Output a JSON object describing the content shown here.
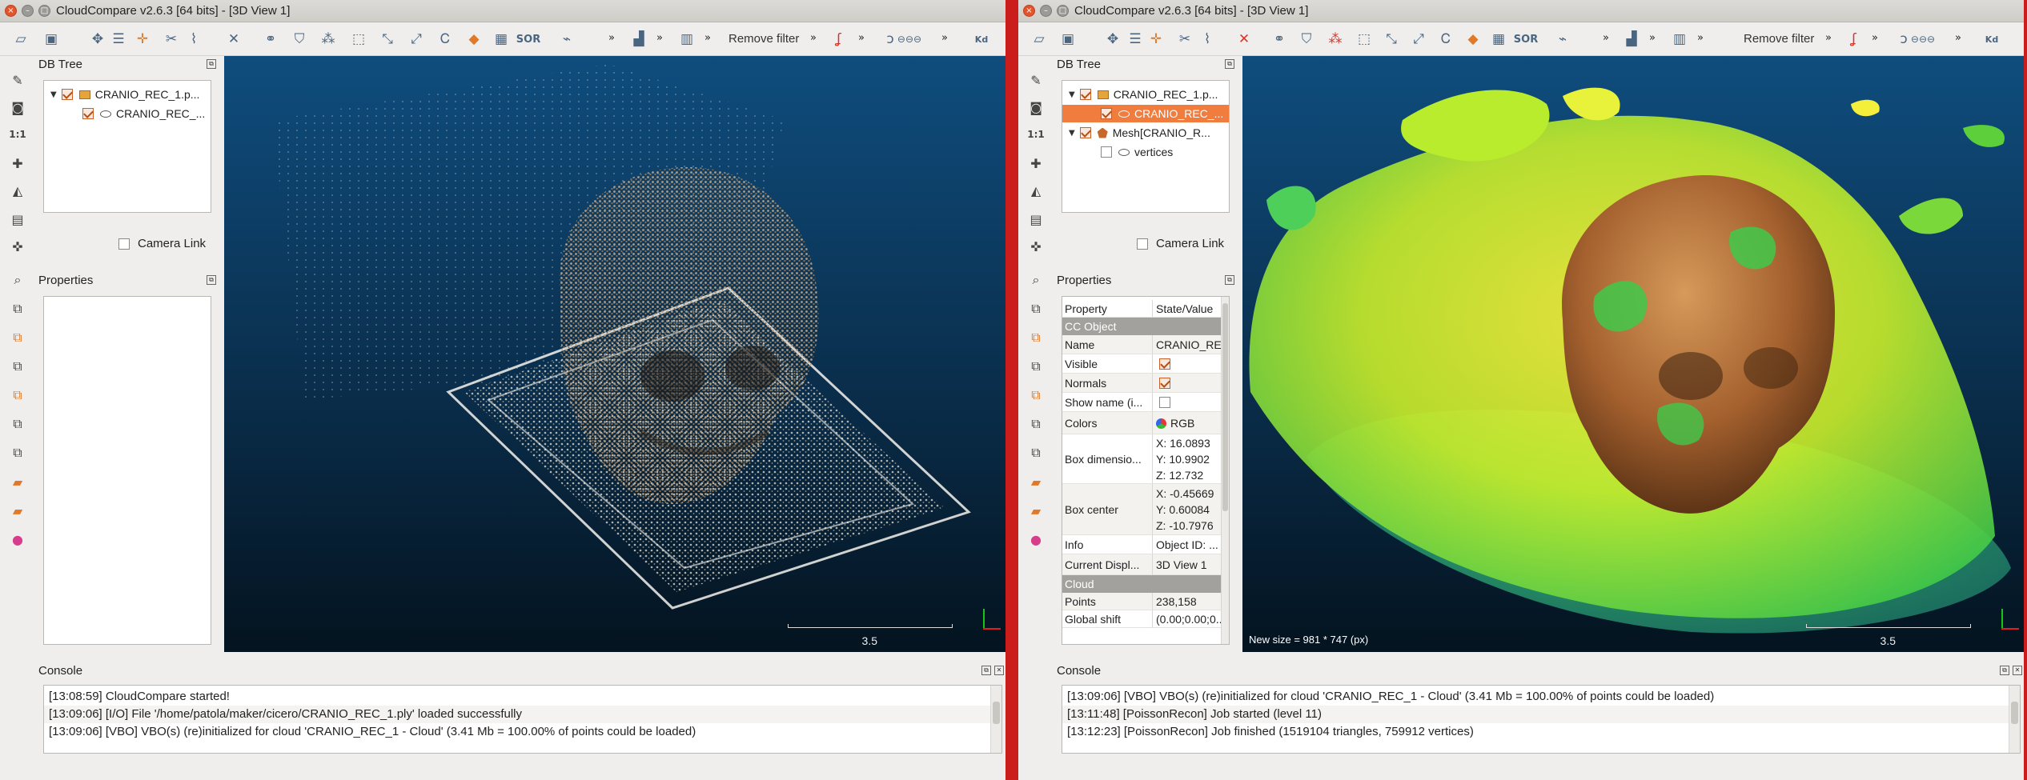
{
  "left_window": {
    "title": "CloudCompare v2.6.3 [64 bits] - [3D View 1]",
    "toolbar": {
      "filter_label": "Remove filter",
      "more": "»",
      "sor_label": "SOR",
      "kd_label": "Kd"
    },
    "db_tree": {
      "title": "DB Tree",
      "items": [
        {
          "label": "CRANIO_REC_1.p...",
          "checked": true
        },
        {
          "label": "CRANIO_REC_...",
          "checked": true
        }
      ]
    },
    "camera_link": "Camera Link",
    "properties_title": "Properties",
    "view": {
      "scale_label": "3.5"
    },
    "console": {
      "title": "Console",
      "lines": [
        "[13:08:59] CloudCompare started!",
        "[13:09:06] [I/O] File '/home/patola/maker/cicero/CRANIO_REC_1.ply' loaded successfully",
        "[13:09:06] [VBO] VBO(s) (re)initialized for cloud 'CRANIO_REC_1 - Cloud' (3.41 Mb = 100.00% of points could be loaded)"
      ]
    },
    "left_icons": {
      "scale_1_1": "1:1"
    }
  },
  "right_window": {
    "title": "CloudCompare v2.6.3 [64 bits] - [3D View 1]",
    "toolbar": {
      "filter_label": "Remove filter",
      "more": "»",
      "sor_label": "SOR",
      "kd_label": "Kd"
    },
    "db_tree": {
      "title": "DB Tree",
      "items": [
        {
          "label": "CRANIO_REC_1.p...",
          "checked": true
        },
        {
          "label": "CRANIO_REC_...",
          "checked": true,
          "selected": true
        },
        {
          "label": "Mesh[CRANIO_R...",
          "checked": true
        },
        {
          "label": "vertices",
          "checked": false
        }
      ]
    },
    "camera_link": "Camera Link",
    "properties": {
      "title": "Properties",
      "header": {
        "property": "Property",
        "value": "State/Value"
      },
      "section_object": "CC Object",
      "section_cloud": "Cloud",
      "name_key": "Name",
      "name_value": "CRANIO_RE",
      "visible_key": "Visible",
      "normals_key": "Normals",
      "showname_key": "Show name (i...",
      "colors_key": "Colors",
      "colors_value": "RGB",
      "boxdim_key": "Box dimensio...",
      "boxdim_x": "X: 16.0893",
      "boxdim_y": "Y: 10.9902",
      "boxdim_z": "Z: 12.732",
      "boxcenter_key": "Box center",
      "boxcenter_x": "X: -0.45669",
      "boxcenter_y": "Y: 0.60084",
      "boxcenter_z": "Z: -10.7976",
      "info_key": "Info",
      "info_value": "Object ID: ...",
      "display_key": "Current Displ...",
      "display_value": "3D View 1",
      "points_key": "Points",
      "points_value": "238,158",
      "shift_key": "Global shift",
      "shift_value": "(0.00;0.00;0..."
    },
    "view": {
      "scale_label": "3.5",
      "new_size": "New size = 981 * 747 (px)"
    },
    "console": {
      "title": "Console",
      "lines": [
        "[13:09:06] [VBO] VBO(s) (re)initialized for cloud 'CRANIO_REC_1 - Cloud' (3.41 Mb = 100.00% of points could be loaded)",
        "[13:11:48] [PoissonRecon] Job started (level 11)",
        "[13:12:23] [PoissonRecon] Job finished (1519104 triangles, 759912 vertices)"
      ]
    },
    "left_icons": {
      "scale_1_1": "1:1"
    }
  },
  "colors": {
    "selection": "#f07c3e",
    "view_top": "#0f4d7e",
    "view_bottom": "#04131f",
    "divider": "#cc1d1d"
  }
}
